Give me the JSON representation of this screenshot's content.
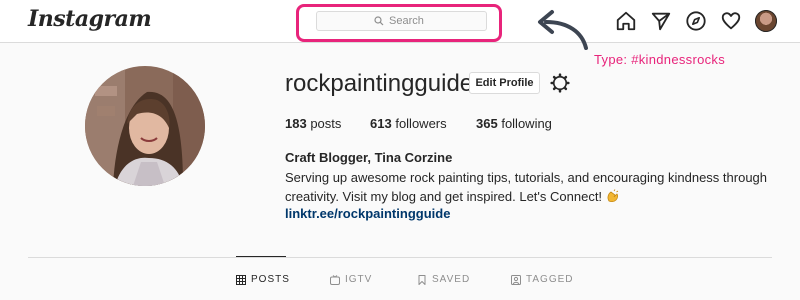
{
  "app": {
    "logo_text": "Instagram"
  },
  "search": {
    "placeholder": "Search"
  },
  "annotation": {
    "text": "Type: #kindnessrocks",
    "color": "#e8247b"
  },
  "nav": {
    "icons": [
      "home-icon",
      "direct-icon",
      "explore-icon",
      "activity-icon",
      "profile-avatar"
    ]
  },
  "profile": {
    "username": "rockpaintingguide",
    "edit_label": "Edit Profile",
    "stats": {
      "posts_count": "183",
      "posts_label": "posts",
      "followers_count": "613",
      "followers_label": "followers",
      "following_count": "365",
      "following_label": "following"
    },
    "bio_name": "Craft Blogger, Tina Corzine",
    "bio_text": "Serving up awesome rock painting tips, tutorials, and encouraging kindness through creativity. Visit my blog and get inspired. Let's Connect!",
    "bio_emoji": "clapping-hands-icon",
    "link": "linktr.ee/rockpaintingguide"
  },
  "tabs": [
    {
      "label": "POSTS",
      "icon": "grid-icon",
      "active": true
    },
    {
      "label": "IGTV",
      "icon": "igtv-icon",
      "active": false
    },
    {
      "label": "SAVED",
      "icon": "bookmark-icon",
      "active": false
    },
    {
      "label": "TAGGED",
      "icon": "tagged-icon",
      "active": false
    }
  ],
  "colors": {
    "accent": "#e8247b",
    "link": "#00376b",
    "text": "#262626",
    "muted": "#8e8e8e"
  }
}
